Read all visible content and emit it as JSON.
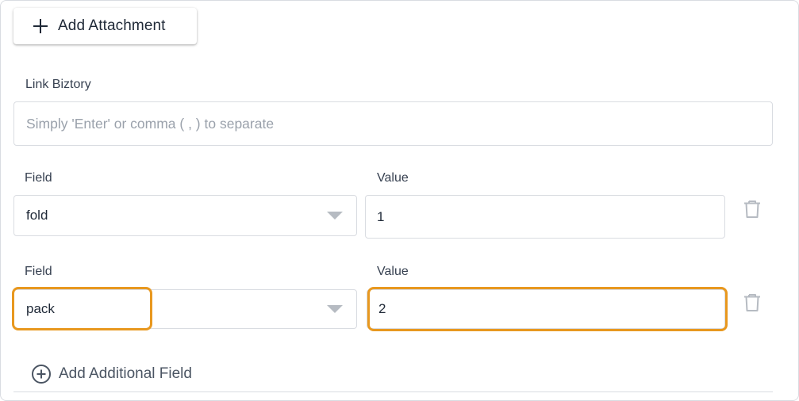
{
  "attachment": {
    "add_label": "Add Attachment"
  },
  "link": {
    "label": "Link Biztory",
    "placeholder": "Simply 'Enter' or comma ( , ) to separate"
  },
  "fields": [
    {
      "field_label": "Field",
      "value_label": "Value",
      "field": "fold",
      "value": "1"
    },
    {
      "field_label": "Field",
      "value_label": "Value",
      "field": "pack",
      "value": "2"
    }
  ],
  "footer": {
    "add_field_label": "Add Additional Field"
  },
  "colors": {
    "highlight": "#e8981f",
    "border": "#d9dce1",
    "placeholder": "#9aa1ab"
  },
  "icons": {
    "add": "plus-icon",
    "dropdown": "caret-down-icon",
    "delete": "trash-icon",
    "add_field": "plus-circle-icon"
  }
}
